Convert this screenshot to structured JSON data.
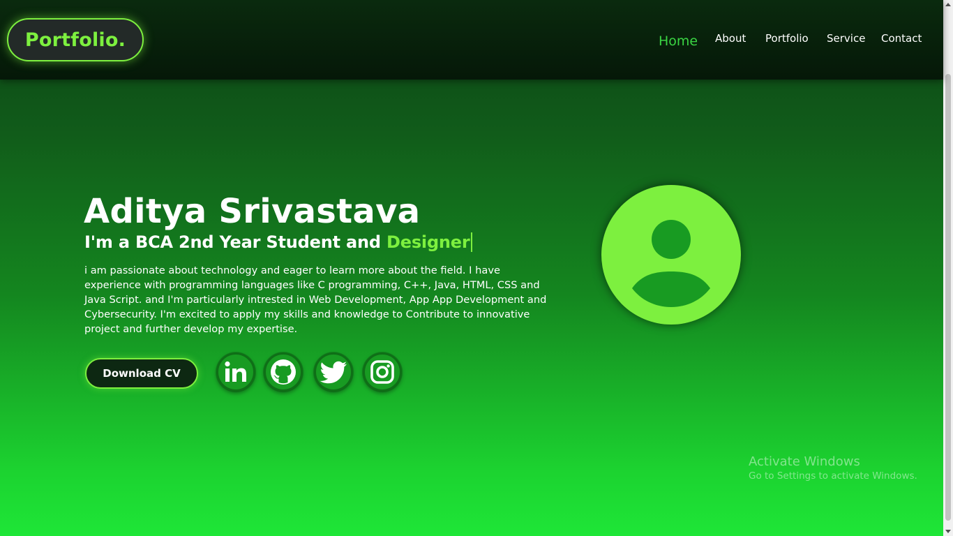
{
  "header": {
    "logo": "Portfolio.",
    "nav": [
      {
        "label": "Home",
        "active": true
      },
      {
        "label": "About",
        "active": false
      },
      {
        "label": "Portfolio",
        "active": false
      },
      {
        "label": "Service",
        "active": false
      },
      {
        "label": "Contact",
        "active": false
      }
    ]
  },
  "hero": {
    "name": "Aditya Srivastava",
    "subtitle_prefix": "I'm a BCA 2nd Year Student and ",
    "subtitle_role": "Designer",
    "description": "i am passionate about technology and eager to learn more about the field. I have experience with programming languages like C programming, C++, Java, HTML, CSS and Java Script. and I'm particularly intrested in Web Development, App App Development and Cybersecurity. I'm excited to apply my skills and knowledge to Contribute to innovative project and further develop my expertise.",
    "download_label": "Download CV",
    "socials": [
      {
        "icon": "linkedin-icon"
      },
      {
        "icon": "github-icon"
      },
      {
        "icon": "twitter-icon"
      },
      {
        "icon": "instagram-icon"
      }
    ]
  },
  "watermark": {
    "line1": "Activate Windows",
    "line2": "Go to Settings to activate Windows."
  },
  "colors": {
    "accent": "#7df03f",
    "nav_active": "#3ad543",
    "header_bg": "#071f0b",
    "bg_top": "#0b4315",
    "bg_bottom": "#1ee637"
  }
}
